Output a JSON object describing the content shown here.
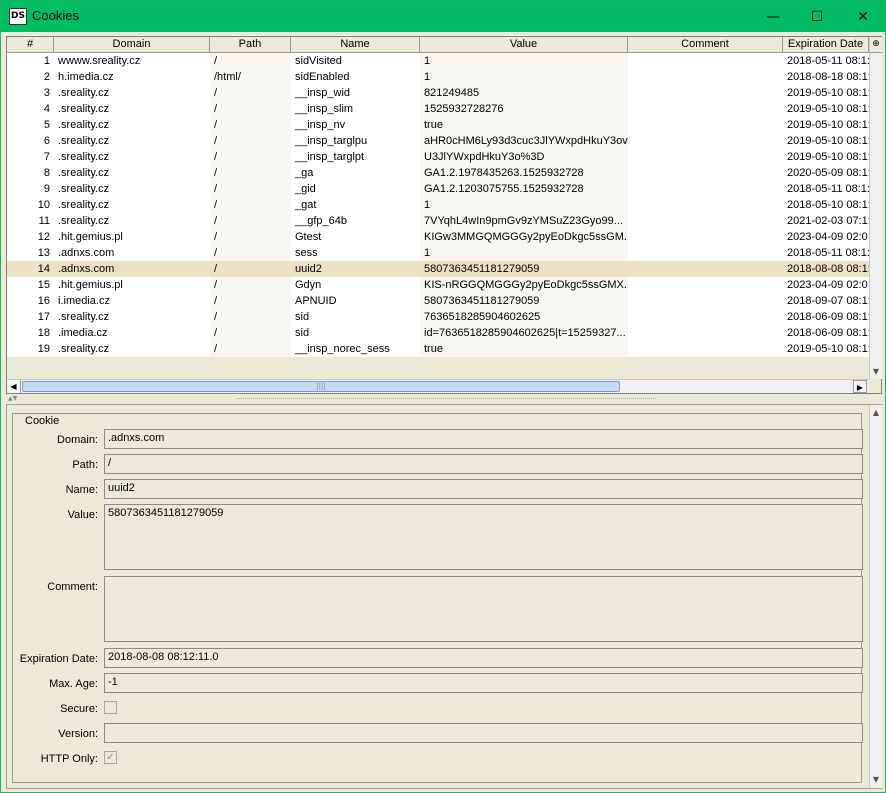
{
  "window": {
    "title": "Cookies",
    "icon_label_1": "D",
    "icon_label_2": "S",
    "minimize_glyph": "—",
    "maximize_glyph": "☐",
    "close_glyph": "✕"
  },
  "table": {
    "columns": [
      "#",
      "Domain",
      "Path",
      "Name",
      "Value",
      "Comment",
      "Expiration Date"
    ],
    "selected_index": 13,
    "rows": [
      {
        "n": "1",
        "domain": "wwww.sreality.cz",
        "path": "/",
        "name": "sidVisited",
        "value": "1",
        "comment": "",
        "exp": "2018-05-11 08:1:"
      },
      {
        "n": "2",
        "domain": "h.imedia.cz",
        "path": "/html/",
        "name": "sidEnabled",
        "value": "1",
        "comment": "",
        "exp": "2018-08-18 08:1:"
      },
      {
        "n": "3",
        "domain": ".sreality.cz",
        "path": "/",
        "name": "__insp_wid",
        "value": "821249485",
        "comment": "",
        "exp": "2019-05-10 08:1:"
      },
      {
        "n": "4",
        "domain": ".sreality.cz",
        "path": "/",
        "name": "__insp_slim",
        "value": "1525932728276",
        "comment": "",
        "exp": "2019-05-10 08:1:"
      },
      {
        "n": "5",
        "domain": ".sreality.cz",
        "path": "/",
        "name": "__insp_nv",
        "value": "true",
        "comment": "",
        "exp": "2019-05-10 08:1:"
      },
      {
        "n": "6",
        "domain": ".sreality.cz",
        "path": "/",
        "name": "__insp_targlpu",
        "value": "aHR0cHM6Ly93d3cuc3JlYWxpdHkuY3ov",
        "comment": "",
        "exp": "2019-05-10 08:1:"
      },
      {
        "n": "7",
        "domain": ".sreality.cz",
        "path": "/",
        "name": "__insp_targlpt",
        "value": "U3JlYWxpdHkuY3o%3D",
        "comment": "",
        "exp": "2019-05-10 08:1:"
      },
      {
        "n": "8",
        "domain": ".sreality.cz",
        "path": "/",
        "name": "_ga",
        "value": "GA1.2.1978435263.1525932728",
        "comment": "",
        "exp": "2020-05-09 08:1:"
      },
      {
        "n": "9",
        "domain": ".sreality.cz",
        "path": "/",
        "name": "_gid",
        "value": "GA1.2.1203075755.1525932728",
        "comment": "",
        "exp": "2018-05-11 08:1:"
      },
      {
        "n": "10",
        "domain": ".sreality.cz",
        "path": "/",
        "name": "_gat",
        "value": "1",
        "comment": "",
        "exp": "2018-05-10 08:1:"
      },
      {
        "n": "11",
        "domain": ".sreality.cz",
        "path": "/",
        "name": "__gfp_64b",
        "value": "7VYqhL4wIn9pmGv9zYMSuZ23Gyo99...",
        "comment": "",
        "exp": "2021-02-03 07:1:"
      },
      {
        "n": "12",
        "domain": ".hit.gemius.pl",
        "path": "/",
        "name": "Gtest",
        "value": "KIGw3MMGQMGGGy2pyEoDkgc5ssGM...",
        "comment": "",
        "exp": "2023-04-09 02:0"
      },
      {
        "n": "13",
        "domain": ".adnxs.com",
        "path": "/",
        "name": "sess",
        "value": "1",
        "comment": "",
        "exp": "2018-05-11 08:1:"
      },
      {
        "n": "14",
        "domain": ".adnxs.com",
        "path": "/",
        "name": "uuid2",
        "value": "5807363451181279059",
        "comment": "",
        "exp": "2018-08-08 08:1:"
      },
      {
        "n": "15",
        "domain": ".hit.gemius.pl",
        "path": "/",
        "name": "Gdyn",
        "value": "KIS-nRGGQMGGGy2pyEoDkgc5ssGMX...",
        "comment": "",
        "exp": "2023-04-09 02:0"
      },
      {
        "n": "16",
        "domain": "i.imedia.cz",
        "path": "/",
        "name": "APNUID",
        "value": "5807363451181279059",
        "comment": "",
        "exp": "2018-09-07 08:1:"
      },
      {
        "n": "17",
        "domain": ".sreality.cz",
        "path": "/",
        "name": "sid",
        "value": "7636518285904602625",
        "comment": "",
        "exp": "2018-06-09 08:1:"
      },
      {
        "n": "18",
        "domain": ".imedia.cz",
        "path": "/",
        "name": "sid",
        "value": "id=7636518285904602625|t=15259327...",
        "comment": "",
        "exp": "2018-06-09 08:1:"
      },
      {
        "n": "19",
        "domain": ".sreality.cz",
        "path": "/",
        "name": "__insp_norec_sess",
        "value": "true",
        "comment": "",
        "exp": "2019-05-10 08:1:"
      }
    ]
  },
  "scroll": {
    "up_arrow": "▲",
    "down_arrow": "▼",
    "left_arrow": "◀",
    "right_arrow": "▶",
    "grip": "||||"
  },
  "detail": {
    "group_label": "Cookie",
    "domain_label": "Domain:",
    "domain_value": ".adnxs.com",
    "path_label": "Path:",
    "path_value": "/",
    "name_label": "Name:",
    "name_value": "uuid2",
    "value_label": "Value:",
    "value_value": "5807363451181279059",
    "comment_label": "Comment:",
    "comment_value": "",
    "expiration_label": "Expiration Date:",
    "expiration_value": "2018-08-08 08:12:11.0",
    "maxage_label": "Max. Age:",
    "maxage_value": "-1",
    "secure_label": "Secure:",
    "secure_checked": false,
    "version_label": "Version:",
    "version_value": "",
    "httponly_label": "HTTP Only:",
    "httponly_checked": true,
    "check_glyph": "✓"
  }
}
